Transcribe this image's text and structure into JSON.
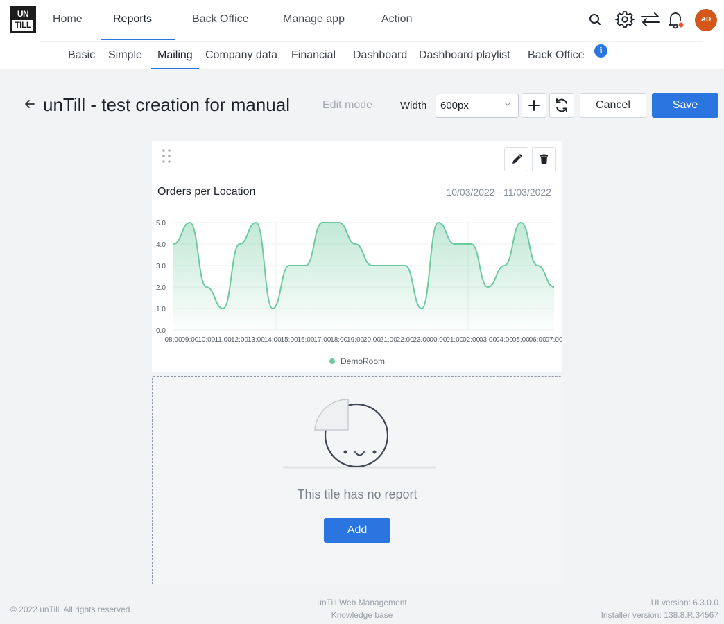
{
  "logo": {
    "top": "UN",
    "bottom": "TILL"
  },
  "nav": {
    "tabs": [
      "Home",
      "Reports",
      "Back Office",
      "Manage app",
      "Action"
    ],
    "active": "Reports",
    "icons": [
      "search-icon",
      "gear-icon",
      "swap-arrows-icon",
      "bell-icon"
    ],
    "notification_dot_color": "#e4572e",
    "avatar": "AD"
  },
  "subnav": {
    "items": [
      "Basic",
      "Simple",
      "Mailing",
      "Company data",
      "Financial",
      "Dashboard",
      "Dashboard playlist",
      "Back Office"
    ],
    "active": "Mailing",
    "info_icon": "i"
  },
  "page": {
    "title": "unTill - test creation for manual",
    "mode": "Edit mode",
    "width_label": "Width",
    "width_value": "600px",
    "cancel": "Cancel",
    "save": "Save"
  },
  "tile1": {
    "title": "Orders per Location",
    "date_range": "10/03/2022 - 11/03/2022"
  },
  "chart_data": {
    "type": "area",
    "title": "Orders per Location",
    "x": [
      "08:00",
      "09:00",
      "10:00",
      "11:00",
      "12:00",
      "13:00",
      "14:00",
      "15:00",
      "16:00",
      "17:00",
      "18:00",
      "19:00",
      "20:00",
      "21:00",
      "22:00",
      "23:00",
      "00:00",
      "01:00",
      "02:00",
      "03:00",
      "04:00",
      "05:00",
      "06:00",
      "07:00"
    ],
    "series": [
      {
        "name": "DemoRoom",
        "color": "#6dcaa0",
        "values": [
          4.0,
          5.0,
          2.0,
          1.0,
          4.0,
          5.0,
          1.0,
          3.0,
          3.0,
          5.0,
          5.0,
          4.0,
          3.0,
          3.0,
          3.0,
          1.0,
          5.0,
          4.0,
          4.0,
          2.0,
          3.0,
          5.0,
          3.0,
          2.0
        ]
      }
    ],
    "y_ticks": [
      "0.0",
      "1.0",
      "2.0",
      "3.0",
      "4.0",
      "5.0"
    ],
    "ylim": [
      0,
      5
    ],
    "grid": true,
    "legend": "bottom-center"
  },
  "tile2": {
    "empty_text": "This tile has no report",
    "add": "Add"
  },
  "footer": {
    "copyright": "© 2022 unTill. All rights reserved.",
    "center_line1": "unTill Web Management",
    "center_line2": "Knowledge base",
    "ui_version": "UI version: 6.3.0.0",
    "installer_version": "Installer version: 138.8.R.34567"
  }
}
